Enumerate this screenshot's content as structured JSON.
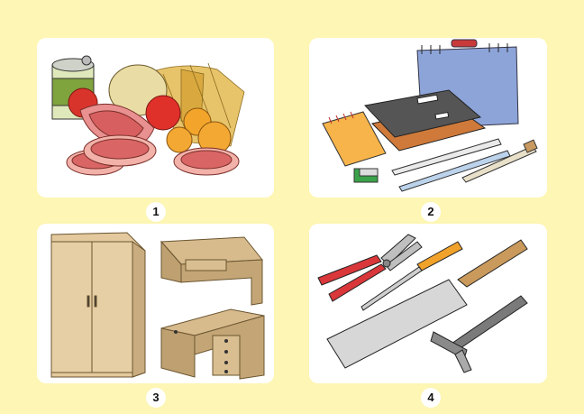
{
  "panels": [
    {
      "number": "1",
      "subject": "food"
    },
    {
      "number": "2",
      "subject": "stationery"
    },
    {
      "number": "3",
      "subject": "furniture"
    },
    {
      "number": "4",
      "subject": "tools"
    }
  ]
}
